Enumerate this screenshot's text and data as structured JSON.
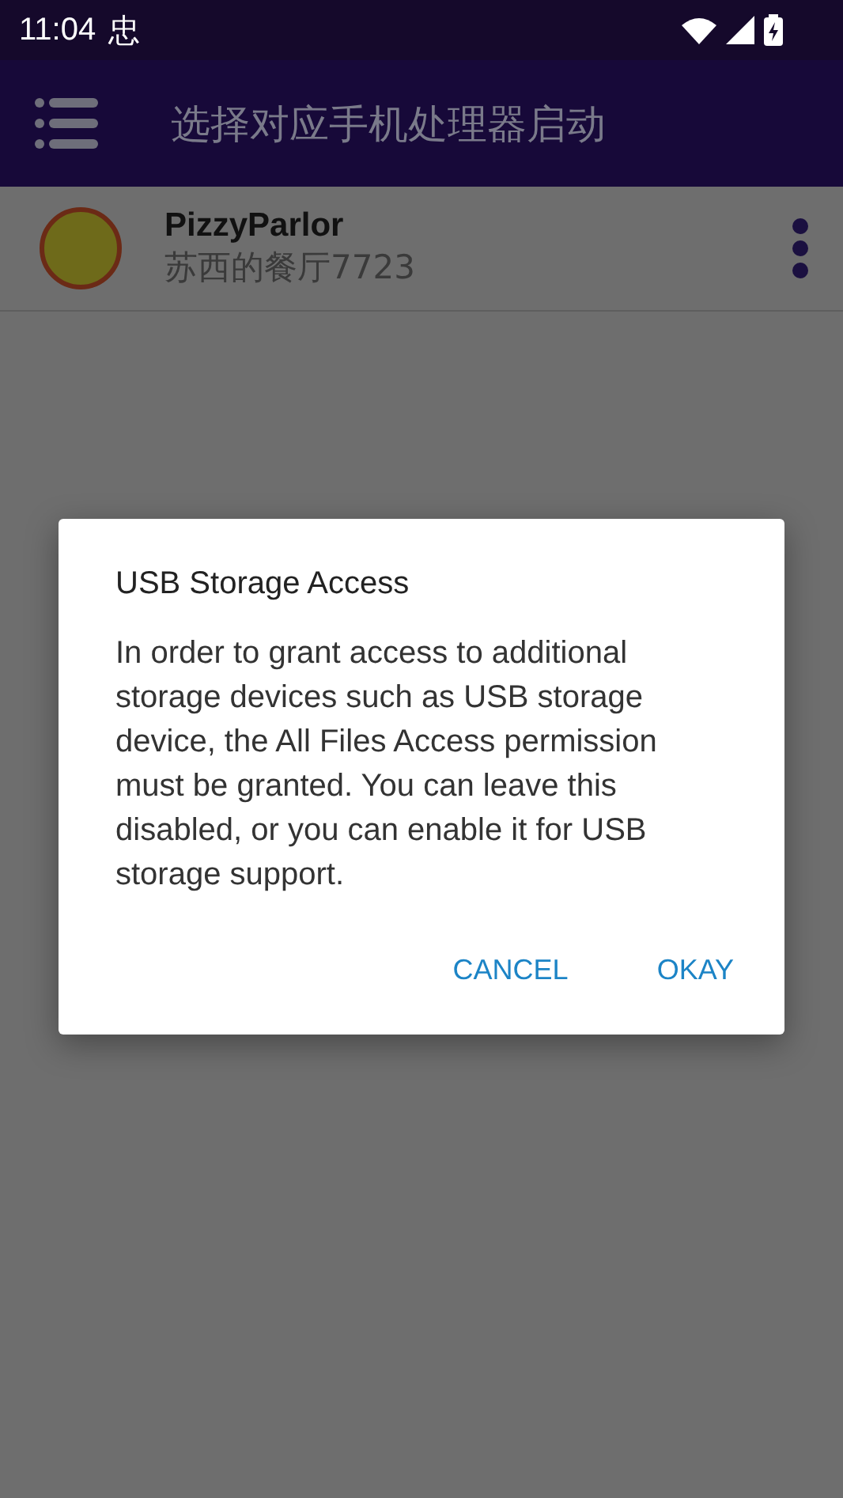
{
  "status_bar": {
    "time": "11:04",
    "notification": "忠"
  },
  "toolbar": {
    "title": "选择对应手机处理器启动"
  },
  "list": [
    {
      "name": "PizzyParlor",
      "subtitle": "苏西的餐厅7723"
    }
  ],
  "dialog": {
    "title": "USB Storage Access",
    "message": "In order to grant access to additional storage devices such as USB storage device, the All Files Access permission must be granted. You can leave this disabled, or you can enable it for USB storage support.",
    "buttons": [
      "CANCEL",
      "OKAY"
    ]
  }
}
